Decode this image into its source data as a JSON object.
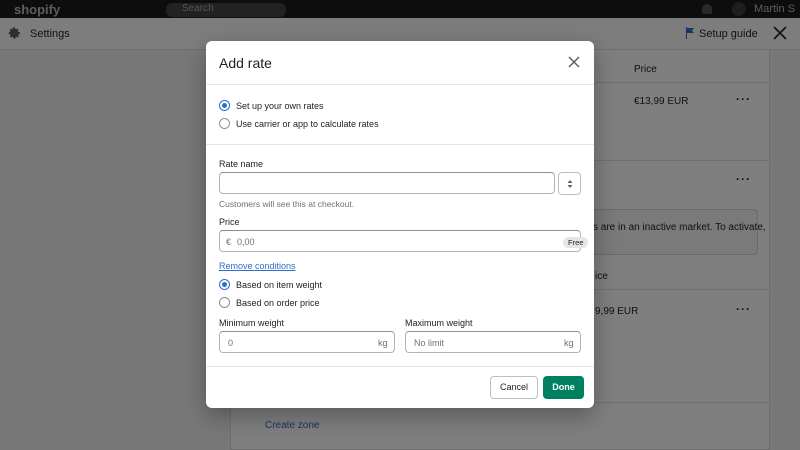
{
  "topbar": {
    "logo": "shopify",
    "search_placeholder": "Search",
    "user": "Martin S"
  },
  "settings_bar": {
    "title": "Settings",
    "setup_guide": "Setup guide"
  },
  "background": {
    "price_header": "Price",
    "price_value": "€13,99 EUR",
    "banner_text": "s are in an inactive market. To activate,",
    "price_header_2": "ice",
    "price_value_2": "9,99 EUR",
    "create_zone": "Create zone"
  },
  "modal": {
    "title": "Add rate",
    "rate_source": {
      "options": [
        {
          "label": "Set up your own rates",
          "checked": true
        },
        {
          "label": "Use carrier or app to calculate rates",
          "checked": false
        }
      ]
    },
    "rate_name": {
      "label": "Rate name",
      "value": "",
      "help": "Customers will see this at checkout."
    },
    "price": {
      "label": "Price",
      "currency": "€",
      "value": "0,00",
      "badge": "Free"
    },
    "remove_conditions": "Remove conditions",
    "conditions": {
      "options": [
        {
          "label": "Based on item weight",
          "checked": true
        },
        {
          "label": "Based on order price",
          "checked": false
        }
      ]
    },
    "min_weight": {
      "label": "Minimum weight",
      "value": "0",
      "unit": "kg"
    },
    "max_weight": {
      "label": "Maximum weight",
      "value": "No limit",
      "unit": "kg"
    },
    "cancel": "Cancel",
    "done": "Done"
  },
  "colors": {
    "primary": "#008060",
    "link": "#2c6ecb",
    "overlay": "rgba(0,0,0,0.5)"
  }
}
